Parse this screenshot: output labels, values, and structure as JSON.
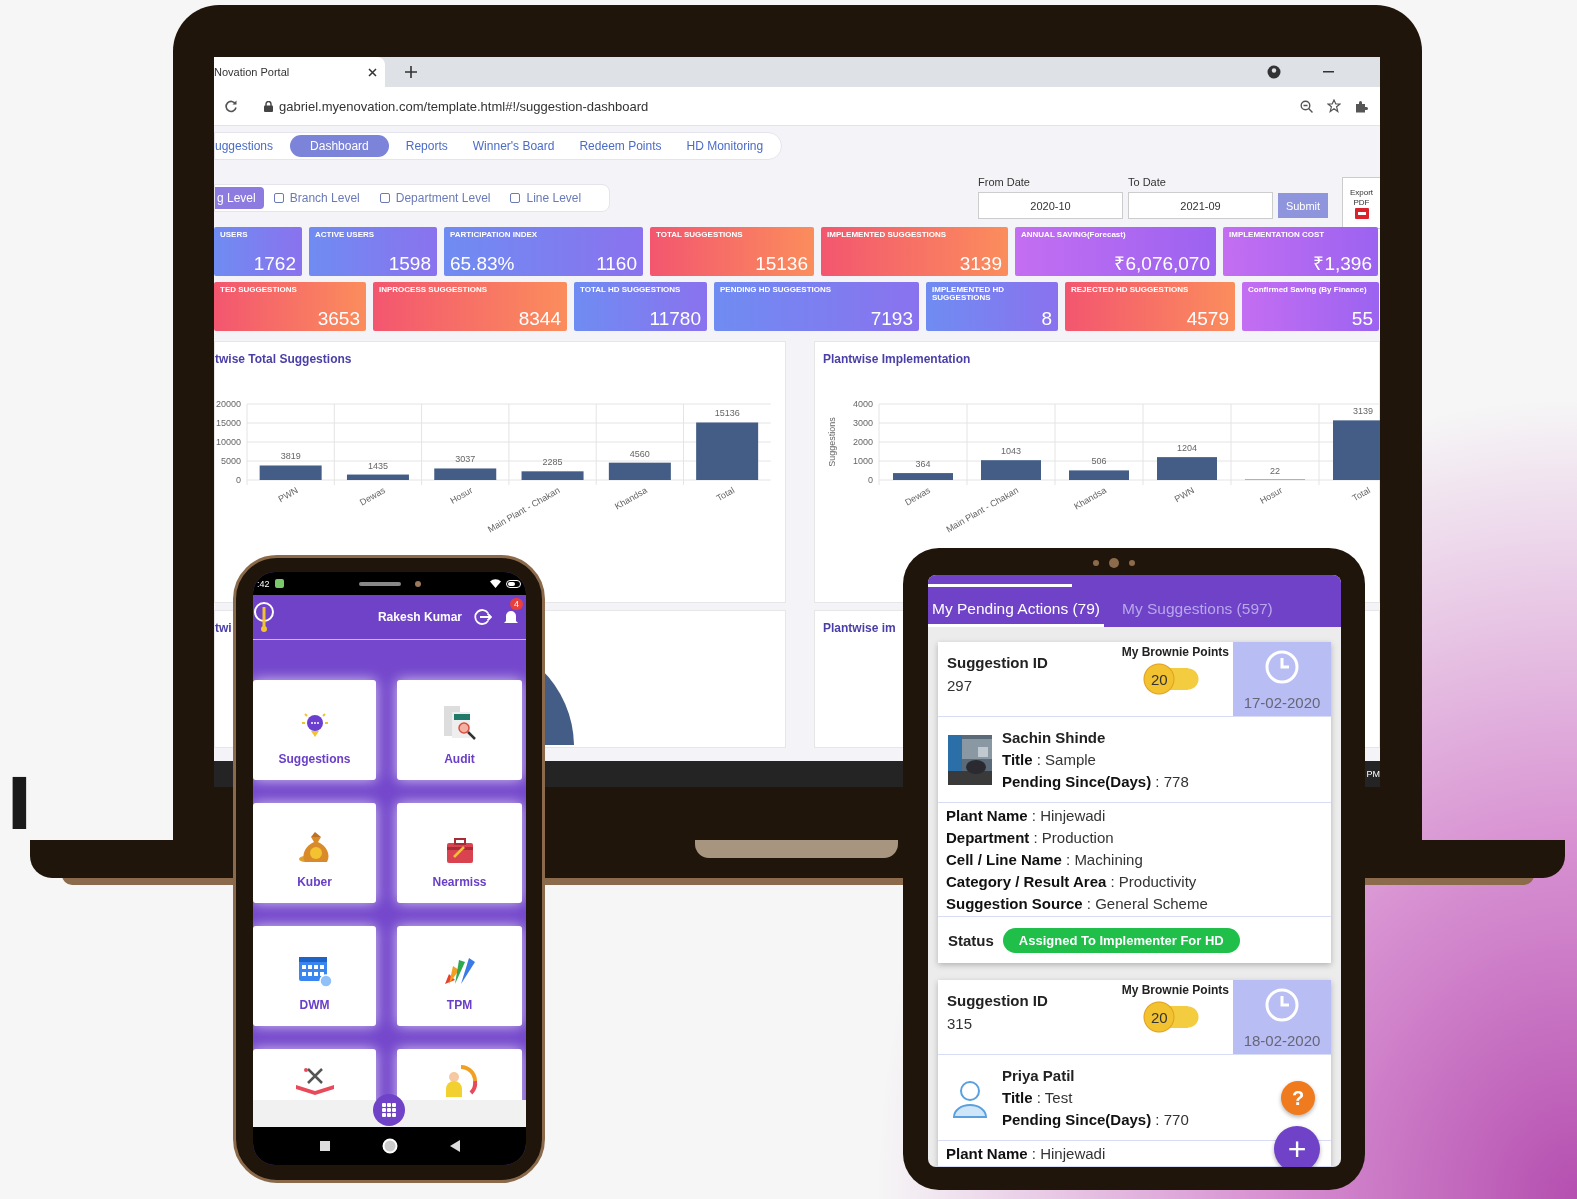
{
  "brand_text": "I",
  "browser": {
    "tab_title": "Novation Portal",
    "url": "gabriel.myenovation.com/template.html#!/suggestion-dashboard"
  },
  "nav_tabs": [
    {
      "label": "uggestions",
      "selected": false
    },
    {
      "label": "Dashboard",
      "selected": true
    },
    {
      "label": "Reports",
      "selected": false
    },
    {
      "label": "Winner's Board",
      "selected": false
    },
    {
      "label": "Redeem Points",
      "selected": false
    },
    {
      "label": "HD Monitoring",
      "selected": false
    }
  ],
  "level_filters": [
    {
      "label": "g Level",
      "selected": true
    },
    {
      "label": "Branch Level",
      "selected": false
    },
    {
      "label": "Department Level",
      "selected": false
    },
    {
      "label": "Line Level",
      "selected": false
    }
  ],
  "date_filter": {
    "from_label": "From Date",
    "from_value": "2020-10",
    "to_label": "To Date",
    "to_value": "2021-09",
    "submit": "Submit",
    "export": "Export",
    "export_format": "PDF"
  },
  "kpi_rows": [
    [
      {
        "label": "USERS",
        "value": "1762",
        "color": "#6f8cf2"
      },
      {
        "label": "ACTIVE USERS",
        "value": "1598",
        "color": "#6f8cf2"
      },
      {
        "label": "PARTICIPATION INDEX",
        "secondary": "65.83%",
        "value": "1160",
        "color": "#6f8cf2"
      },
      {
        "label": "TOTAL SUGGESTIONS",
        "value": "15136",
        "color": "#f3566f"
      },
      {
        "label": "IMPLEMENTED SUGGESTIONS",
        "value": "3139",
        "color": "#f3566f"
      },
      {
        "label": "ANNUAL SAVING(Forecast)",
        "value": "₹6,076,070",
        "color": "#c46ef2"
      },
      {
        "label": "IMPLEMENTATION COST",
        "value": "₹1,396",
        "color": "#c46ef2"
      }
    ],
    [
      {
        "label": "TED SUGGESTIONS",
        "value": "3653",
        "color": "#f3566f"
      },
      {
        "label": "INPROCESS SUGGESTIONS",
        "value": "8344",
        "color": "#f3566f"
      },
      {
        "label": "TOTAL HD SUGGESTIONS",
        "value": "11780",
        "color": "#6f8cf2"
      },
      {
        "label": "PENDING HD SUGGESTIONS",
        "value": "7193",
        "color": "#6f8cf2"
      },
      {
        "label": "IMPLEMENTED HD SUGGESTIONS",
        "value": "8",
        "color": "#6f8cf2"
      },
      {
        "label": "REJECTED HD SUGGESTIONS",
        "value": "4579",
        "color": "#f3566f"
      },
      {
        "label": "Confirmed Saving (By Finance)",
        "value": "55",
        "color": "#c46ef2"
      }
    ]
  ],
  "charts": [
    {
      "title": "twise Total Suggestions",
      "chart_data": {
        "type": "bar",
        "categories": [
          "PWN",
          "Dewas",
          "Hosur",
          "Main Plant - Chakan",
          "Khandsa",
          "Total"
        ],
        "values": [
          3819,
          1435,
          3037,
          2285,
          4560,
          15136
        ],
        "ylim": [
          0,
          20000
        ],
        "yticks": [
          0,
          5000,
          10000,
          15000,
          20000
        ],
        "grid": true,
        "data_labels": true
      }
    },
    {
      "title": "Plantwise Implementation",
      "chart_data": {
        "type": "bar",
        "ylabel": "Suggestions",
        "categories": [
          "Dewas",
          "Main Plant - Chakan",
          "Khandsa",
          "PWN",
          "Hosur",
          "Total"
        ],
        "values": [
          364,
          1043,
          506,
          1204,
          22,
          3139
        ],
        "ylim": [
          0,
          4000
        ],
        "yticks": [
          0,
          1000,
          2000,
          3000,
          4000
        ],
        "grid": true,
        "data_labels": true
      }
    }
  ],
  "lower_panels": [
    {
      "title": "twi"
    },
    {
      "title": "Plantwise im"
    }
  ],
  "taskbar": {
    "clock": "PM"
  },
  "phone": {
    "status_time": ":42",
    "user": "Rakesh Kumar",
    "badge": "4",
    "tiles": [
      {
        "label": "Suggestions",
        "kind": "bulb"
      },
      {
        "label": "Audit",
        "kind": "audit"
      },
      {
        "label": "Kuber",
        "kind": "moneybag"
      },
      {
        "label": "Nearmiss",
        "kind": "toolbox"
      },
      {
        "label": "DWM",
        "kind": "calendar"
      },
      {
        "label": "TPM",
        "kind": "fan"
      },
      {
        "kind": "tools"
      },
      {
        "kind": "gauge"
      }
    ]
  },
  "tablet": {
    "tabs": [
      {
        "label": "My Pending Actions (79)",
        "selected": true
      },
      {
        "label": "My Suggestions (597)",
        "selected": false
      }
    ],
    "cards": [
      {
        "id_label": "Suggestion ID",
        "id": "297",
        "points_label": "My Brownie Points",
        "points": "20",
        "date": "17-02-2020",
        "name": "Sachin Shinde",
        "title_line": "**Title** : Sample",
        "pending_line": "**Pending Since(Days)** : 778",
        "details": [
          "**Plant Name** :  Hinjewadi",
          "**Department** :  Production",
          "**Cell / Line Name** :  Machining",
          "**Category / Result Area** :  Productivity",
          "**Suggestion Source** :  General Scheme"
        ],
        "status_label": "Status",
        "status": "Assigned To Implementer For HD"
      },
      {
        "id_label": "Suggestion ID",
        "id": "315",
        "points_label": "My Brownie Points",
        "points": "20",
        "date": "18-02-2020",
        "kind": "person",
        "name": "Priya Patil",
        "title_line": "**Title** : Test",
        "pending_line": "**Pending Since(Days)** : 770",
        "details": [
          "**Plant Name** :  Hinjewadi"
        ]
      }
    ],
    "help_button": "?",
    "add_button": "+"
  }
}
